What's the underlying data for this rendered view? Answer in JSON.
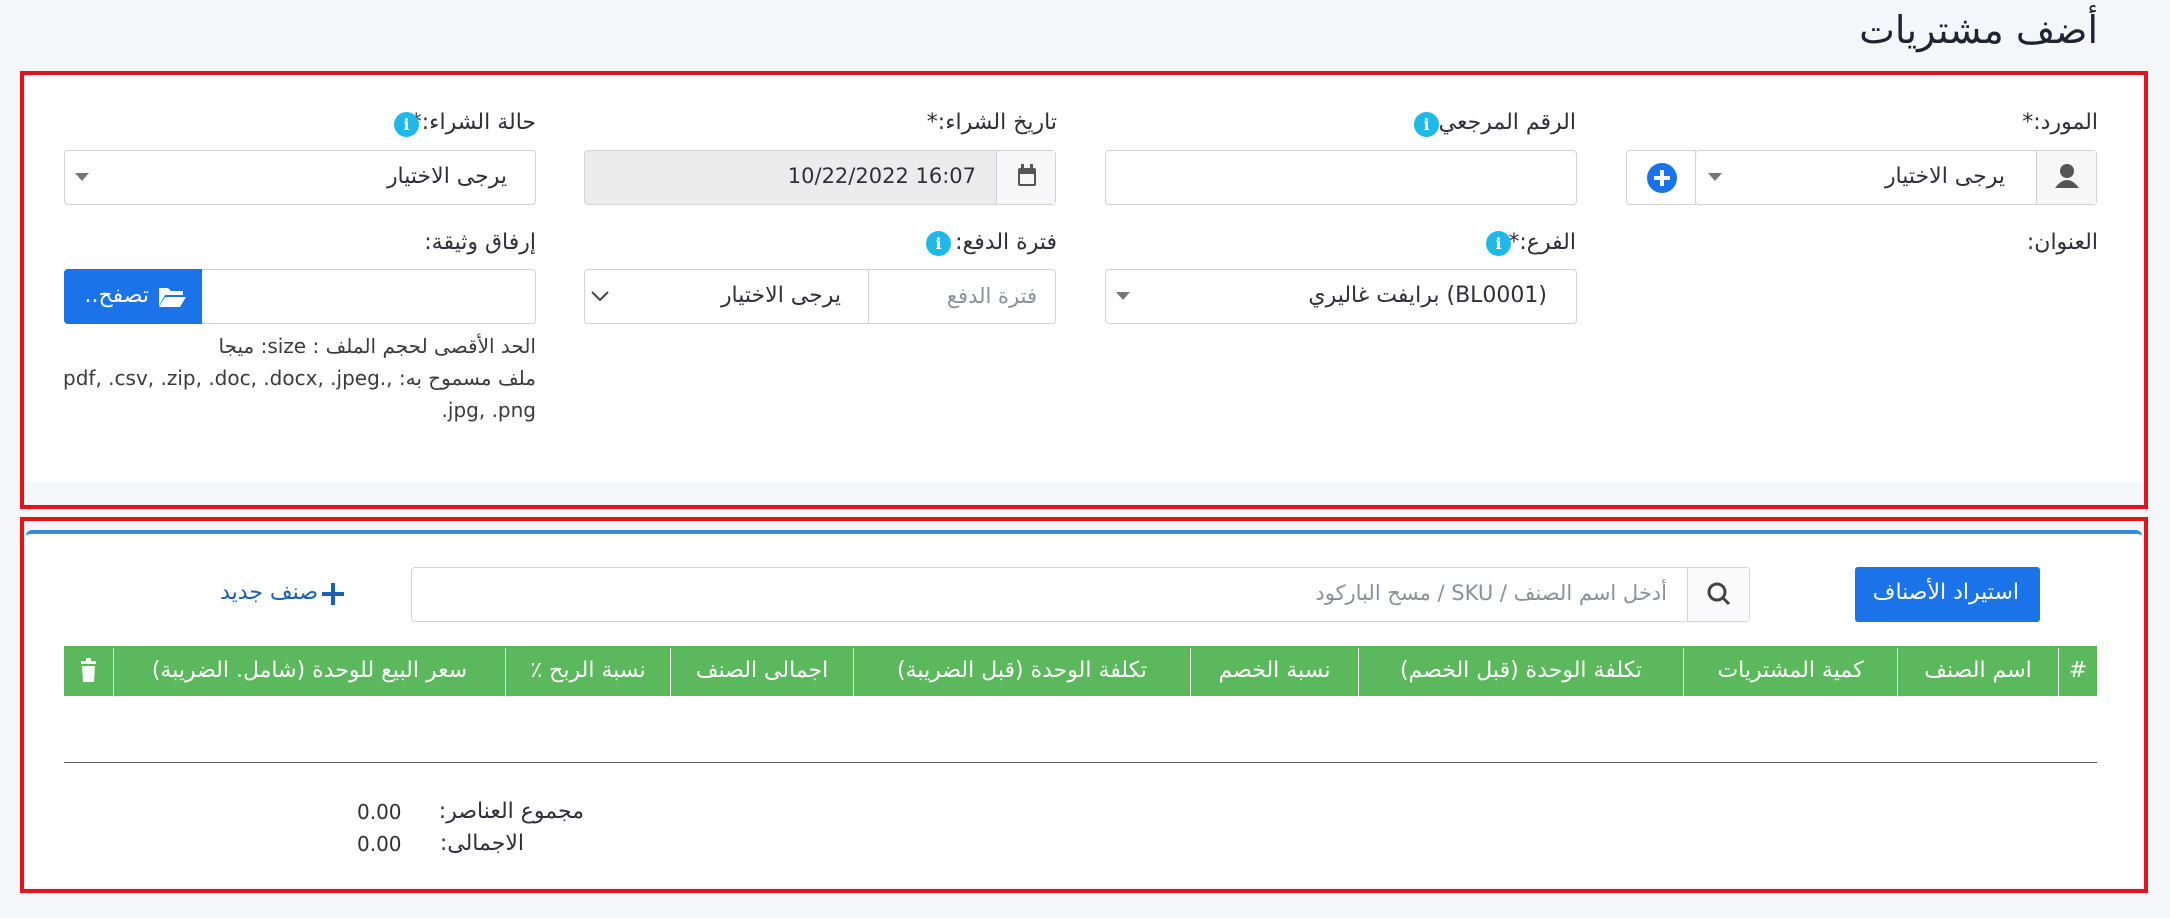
{
  "page_title": "أضف مشتريات",
  "form": {
    "supplier_label": "المورد:*",
    "supplier_value": "يرجى الاختيار",
    "ref_label": "الرقم المرجعي:",
    "ref_value": "",
    "date_label": "تاريخ الشراء:*",
    "date_value": "10/22/2022 16:07",
    "status_label": "حالة الشراء:*",
    "status_value": "يرجى الاختيار",
    "address_label": "العنوان:",
    "branch_label": "الفرع:*",
    "branch_value": "برايفت غاليري (BL0001)",
    "pay_term_label": "فترة الدفع:",
    "pay_term_placeholder": "فترة الدفع",
    "pay_term_select": "يرجى الاختيار",
    "attach_label": "إرفاق وثيقة:",
    "browse_label": "تصفح..",
    "help_line1": "الحد الأقصى لحجم الملف : size: ميجا",
    "help_line2": "ملف مسموح به: ,.pdf, .csv, .zip, .doc, .docx, .jpeg",
    "help_line3": ".jpg, .png"
  },
  "items": {
    "import_button": "استيراد الأصناف",
    "search_placeholder": "أدخل اسم الصنف / SKU / مسح الباركود",
    "new_item": "صنف جديد",
    "columns": [
      "#",
      "اسم الصنف",
      "كمية المشتريات",
      "تكلفة الوحدة (قبل الخصم)",
      "نسبة الخصم",
      "تكلفة الوحدة (قبل الضريبة)",
      "اجمالى الصنف",
      "نسبة الربح ٪",
      "سعر البيع للوحدة (شامل. الضريبة)"
    ],
    "total_items_label": "مجموع العناصر:",
    "total_items_value": "0.00",
    "total_label": "الاجمالى:",
    "total_value": "0.00"
  },
  "colors": {
    "accent": "#1a73e8",
    "table_header": "#5cb85c",
    "frame": "#e3131b",
    "info": "#20b8e8"
  }
}
